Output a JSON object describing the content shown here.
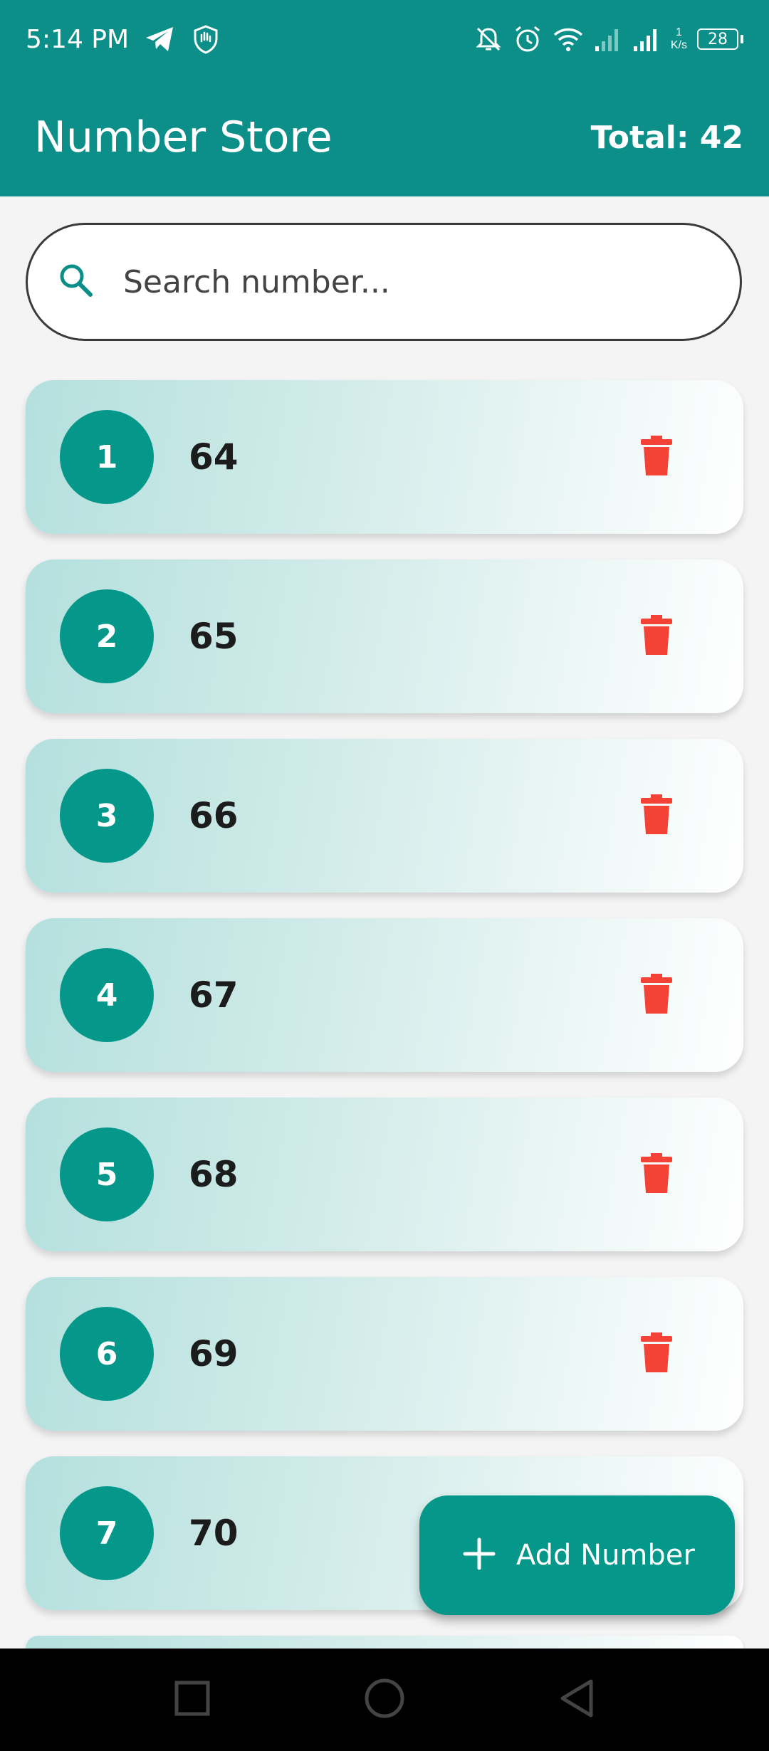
{
  "status_bar": {
    "time": "5:14 PM",
    "speed_value": "1",
    "speed_unit": "K/s",
    "battery": "28",
    "icons": [
      "telegram-icon",
      "hand-shield-icon",
      "bell-off-icon",
      "alarm-icon",
      "wifi-icon",
      "signal-icon",
      "signal-icon"
    ]
  },
  "app_bar": {
    "title": "Number Store",
    "total": "Total: 42"
  },
  "search": {
    "placeholder": "Search number..."
  },
  "items": [
    {
      "index": "1",
      "value": "64"
    },
    {
      "index": "2",
      "value": "65"
    },
    {
      "index": "3",
      "value": "66"
    },
    {
      "index": "4",
      "value": "67"
    },
    {
      "index": "5",
      "value": "68"
    },
    {
      "index": "6",
      "value": "69"
    },
    {
      "index": "7",
      "value": "70"
    }
  ],
  "fab": {
    "label": "Add Number"
  },
  "colors": {
    "primary": "#0c8f89",
    "badge": "#05978a",
    "delete": "#f44336",
    "background": "#f4f4f4"
  }
}
